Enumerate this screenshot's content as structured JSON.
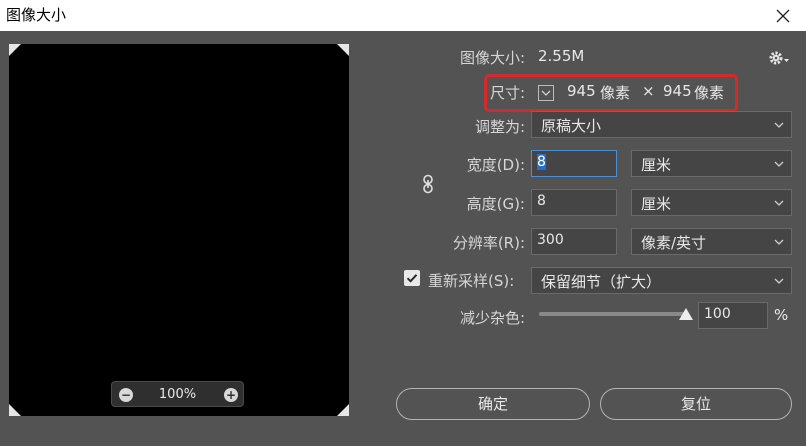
{
  "window": {
    "title": "图像大小"
  },
  "preview": {
    "zoom": "100%"
  },
  "info": {
    "size_label": "图像大小:",
    "size_value": "2.55M"
  },
  "dimensions": {
    "label": "尺寸:",
    "width": "945",
    "width_unit": "像素",
    "times": "×",
    "height": "945",
    "height_unit": "像素"
  },
  "fit_to": {
    "label": "调整为:",
    "value": "原稿大小"
  },
  "width_row": {
    "label": "宽度(D):",
    "value": "8",
    "unit": "厘米"
  },
  "height_row": {
    "label": "高度(G):",
    "value": "8",
    "unit": "厘米"
  },
  "resolution_row": {
    "label": "分辨率(R):",
    "value": "300",
    "unit": "像素/英寸"
  },
  "resample": {
    "label": "重新采样(S):",
    "checked": true,
    "value": "保留细节（扩大）"
  },
  "noise": {
    "label": "减少杂色:",
    "value": "100",
    "unit": "%",
    "level": 1.0
  },
  "buttons": {
    "ok": "确定",
    "reset": "复位"
  },
  "colors": {
    "dialog_bg": "#535353",
    "highlight": "#d42a2a",
    "focus": "#4d8fd6"
  },
  "icons": [
    "close-icon",
    "gear-icon",
    "zoom-out-icon",
    "zoom-in-icon",
    "link-icon",
    "checkmark-icon",
    "chevron-down-icon"
  ]
}
